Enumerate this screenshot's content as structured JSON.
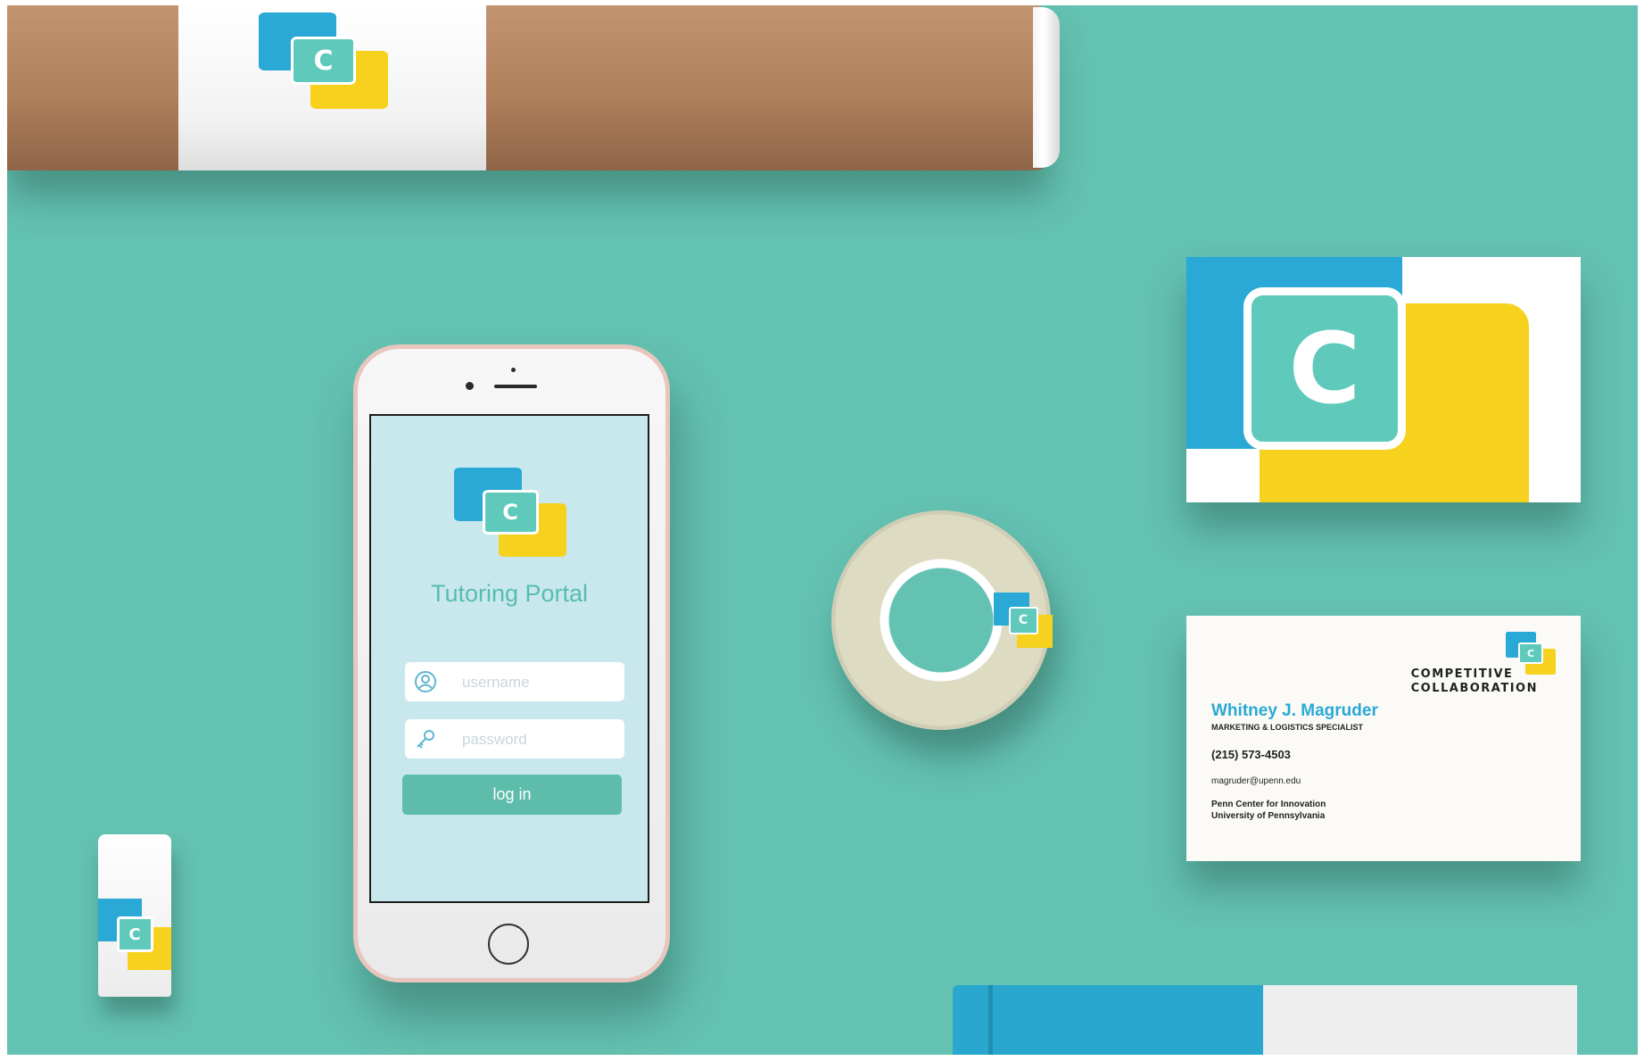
{
  "colors": {
    "background": "#64c2b2",
    "logo_blue": "#2aa9d6",
    "logo_yellow": "#f6d21e",
    "logo_teal": "#5fcabb",
    "button_teal": "#5dbcaa",
    "screen_bg": "#c9e8ee"
  },
  "logo": {
    "letter": "C"
  },
  "phone_app": {
    "title": "Tutoring Portal",
    "username_placeholder": "username",
    "password_placeholder": "password",
    "login_label": "log in",
    "icons": {
      "username": "user-icon",
      "password": "key-icon"
    }
  },
  "business_card": {
    "company_line1": "COMPETITIVE",
    "company_line2": "COLLABORATION",
    "name": "Whitney J. Magruder",
    "role": "MARKETING & LOGISTICS SPECIALIST",
    "phone": "(215) 573-4503",
    "email": "magruder@upenn.edu",
    "org_line1": "Penn Center for Innovation",
    "org_line2": "University of Pennsylvania"
  }
}
